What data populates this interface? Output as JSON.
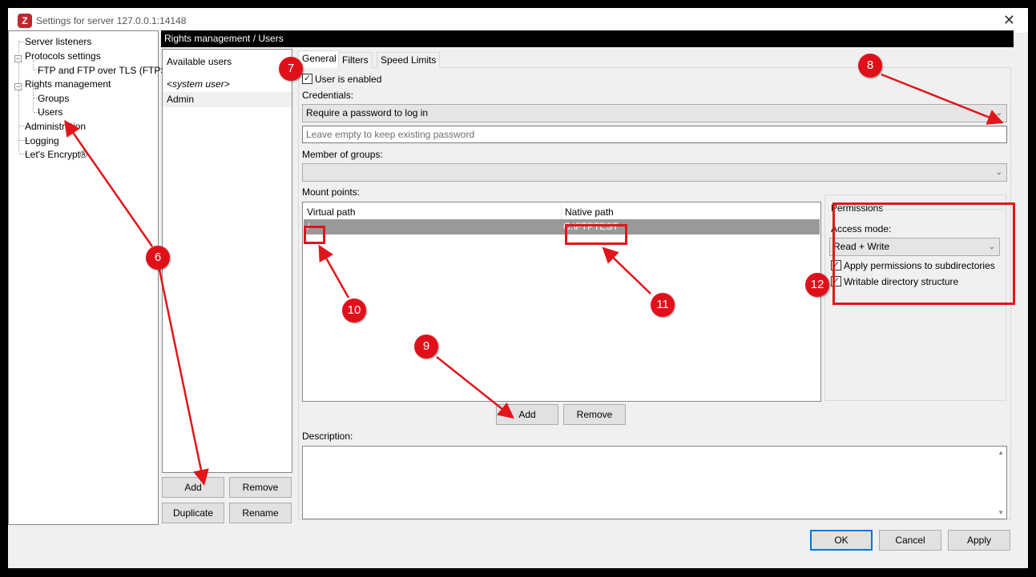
{
  "window": {
    "title": "Settings for server 127.0.0.1:14148",
    "app_icon_label": "Z"
  },
  "tree": {
    "items": [
      {
        "label": "Server listeners"
      },
      {
        "label": "Protocols settings"
      },
      {
        "label": "FTP and FTP over TLS (FTPS)"
      },
      {
        "label": "Rights management"
      },
      {
        "label": "Groups"
      },
      {
        "label": "Users"
      },
      {
        "label": "Administration"
      },
      {
        "label": "Logging"
      },
      {
        "label": "Let's Encrypt®"
      }
    ],
    "expander_symbol": "−"
  },
  "page_header": "Rights management / Users",
  "users": {
    "header": "Available users",
    "items": [
      "<system user>",
      "Admin"
    ],
    "buttons": {
      "add": "Add",
      "remove": "Remove",
      "duplicate": "Duplicate",
      "rename": "Rename"
    }
  },
  "tabs": [
    "General",
    "Filters",
    "Speed Limits"
  ],
  "general": {
    "user_enabled_label": "User is enabled",
    "credentials_label": "Credentials:",
    "credentials_value": "Require a password to log in",
    "password_placeholder": "Leave empty to keep existing password",
    "member_of_groups_label": "Member of groups:",
    "member_of_groups_value": "",
    "mount_points_label": "Mount points:",
    "mount_columns": [
      "Virtual path",
      "Native path"
    ],
    "mount_rows": [
      {
        "virtual": "/",
        "native": "C:\\FTPTEST"
      }
    ],
    "mount_buttons": {
      "add": "Add",
      "remove": "Remove"
    },
    "permissions": {
      "legend": "Permissions",
      "access_mode_label": "Access mode:",
      "access_mode_value": "Read + Write",
      "apply_subdirs_label": "Apply permissions to subdirectories",
      "writable_structure_label": "Writable directory structure"
    },
    "description_label": "Description:",
    "description_value": ""
  },
  "dialog_buttons": {
    "ok": "OK",
    "cancel": "Cancel",
    "apply": "Apply"
  },
  "icons": {
    "checkmark": "✓",
    "chevron_down": "⌄",
    "close": "✕",
    "scroll_up": "▲",
    "scroll_down": "▼"
  },
  "annotations": {
    "markers": [
      "6",
      "7",
      "8",
      "9",
      "10",
      "11",
      "12"
    ],
    "color": "#e0161b"
  }
}
